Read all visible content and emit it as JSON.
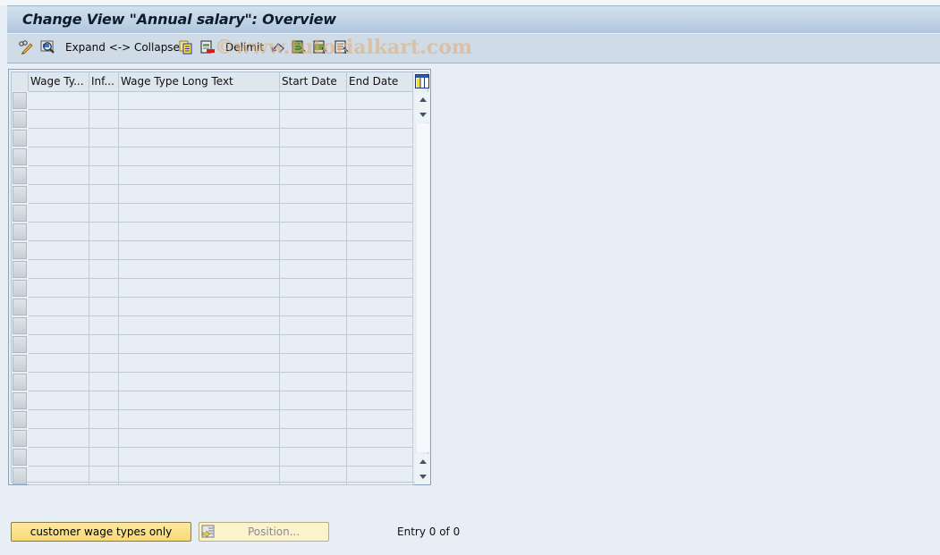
{
  "window": {
    "title": "Change View \"Annual salary\": Overview"
  },
  "toolbar": {
    "items": [
      {
        "name": "display-change-toggle",
        "icon": "pencil-glasses-icon",
        "label": ""
      },
      {
        "name": "details",
        "icon": "magnifier-details-icon",
        "label": ""
      },
      {
        "name": "expand-collapse",
        "icon": "",
        "label": "Expand <-> Collapse"
      },
      {
        "name": "copy-as",
        "icon": "copy-icon",
        "label": ""
      },
      {
        "name": "delete",
        "icon": "delete-row-icon",
        "label": ""
      },
      {
        "name": "delimit",
        "icon": "",
        "label": "Delimit"
      },
      {
        "name": "undo-change",
        "icon": "undo-icon",
        "label": ""
      },
      {
        "name": "select-all",
        "icon": "select-all-icon",
        "label": ""
      },
      {
        "name": "select-block",
        "icon": "select-block-icon",
        "label": ""
      },
      {
        "name": "deselect-all",
        "icon": "deselect-all-icon",
        "label": ""
      }
    ],
    "watermark": "©www.tutorialkart.com"
  },
  "table": {
    "columns": [
      {
        "key": "wage_type",
        "label": "Wage Ty..."
      },
      {
        "key": "inf",
        "label": "Inf..."
      },
      {
        "key": "long_text",
        "label": "Wage Type Long Text"
      },
      {
        "key": "start_date",
        "label": "Start Date"
      },
      {
        "key": "end_date",
        "label": "End Date"
      }
    ],
    "rows": [],
    "visible_empty_rows": 21,
    "column_config_icon": "table-settings-icon"
  },
  "footer": {
    "customer_button": "customer wage types only",
    "position_button": "Position...",
    "entry_status": "Entry 0 of 0"
  },
  "colors": {
    "title_gradient_top": "#d3e1ee",
    "title_gradient_bottom": "#b0c6dd",
    "toolbar_bg": "#cfdbe6",
    "page_bg": "#e8eef5",
    "primary_button": "#f8d975"
  }
}
